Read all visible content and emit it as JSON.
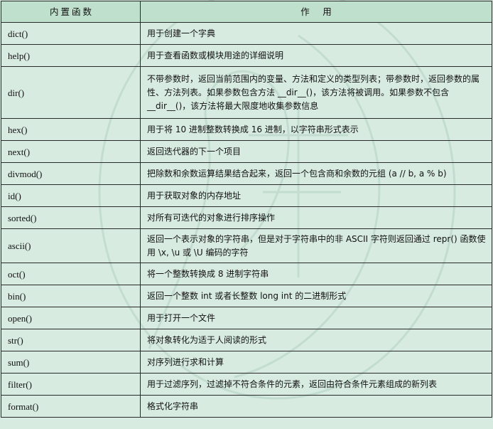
{
  "table": {
    "header": {
      "name": "内置函数",
      "desc": "作　用"
    },
    "rows": [
      {
        "name": "dict()",
        "desc": "用于创建一个字典"
      },
      {
        "name": "help()",
        "desc": "用于查看函数或模块用途的详细说明"
      },
      {
        "name": "dir()",
        "desc": "不带参数时，返回当前范围内的变量、方法和定义的类型列表；带参数时，返回参数的属性、方法列表。如果参数包含方法 __dir__()，该方法将被调用。如果参数不包含 __dir__()，该方法将最大限度地收集参数信息"
      },
      {
        "name": "hex()",
        "desc": "用于将 10 进制整数转换成 16 进制，以字符串形式表示"
      },
      {
        "name": "next()",
        "desc": "返回迭代器的下一个项目"
      },
      {
        "name": "divmod()",
        "desc": "把除数和余数运算结果结合起来，返回一个包含商和余数的元组 (a // b, a % b)"
      },
      {
        "name": "id()",
        "desc": "用于获取对象的内存地址"
      },
      {
        "name": "sorted()",
        "desc": "对所有可迭代的对象进行排序操作"
      },
      {
        "name": "ascii()",
        "desc": "返回一个表示对象的字符串，但是对于字符串中的非 ASCII 字符则返回通过 repr() 函数使用 \\x, \\u 或 \\U 编码的字符"
      },
      {
        "name": "oct()",
        "desc": "将一个整数转换成 8 进制字符串"
      },
      {
        "name": "bin()",
        "desc": "返回一个整数 int 或者长整数 long int 的二进制形式"
      },
      {
        "name": "open()",
        "desc": "用于打开一个文件"
      },
      {
        "name": "str()",
        "desc": "将对象转化为适于人阅读的形式"
      },
      {
        "name": "sum()",
        "desc": "对序列进行求和计算"
      },
      {
        "name": "filter()",
        "desc": "用于过滤序列，过滤掉不符合条件的元素，返回由符合条件元素组成的新列表"
      },
      {
        "name": "format()",
        "desc": "格式化字符串"
      }
    ]
  }
}
